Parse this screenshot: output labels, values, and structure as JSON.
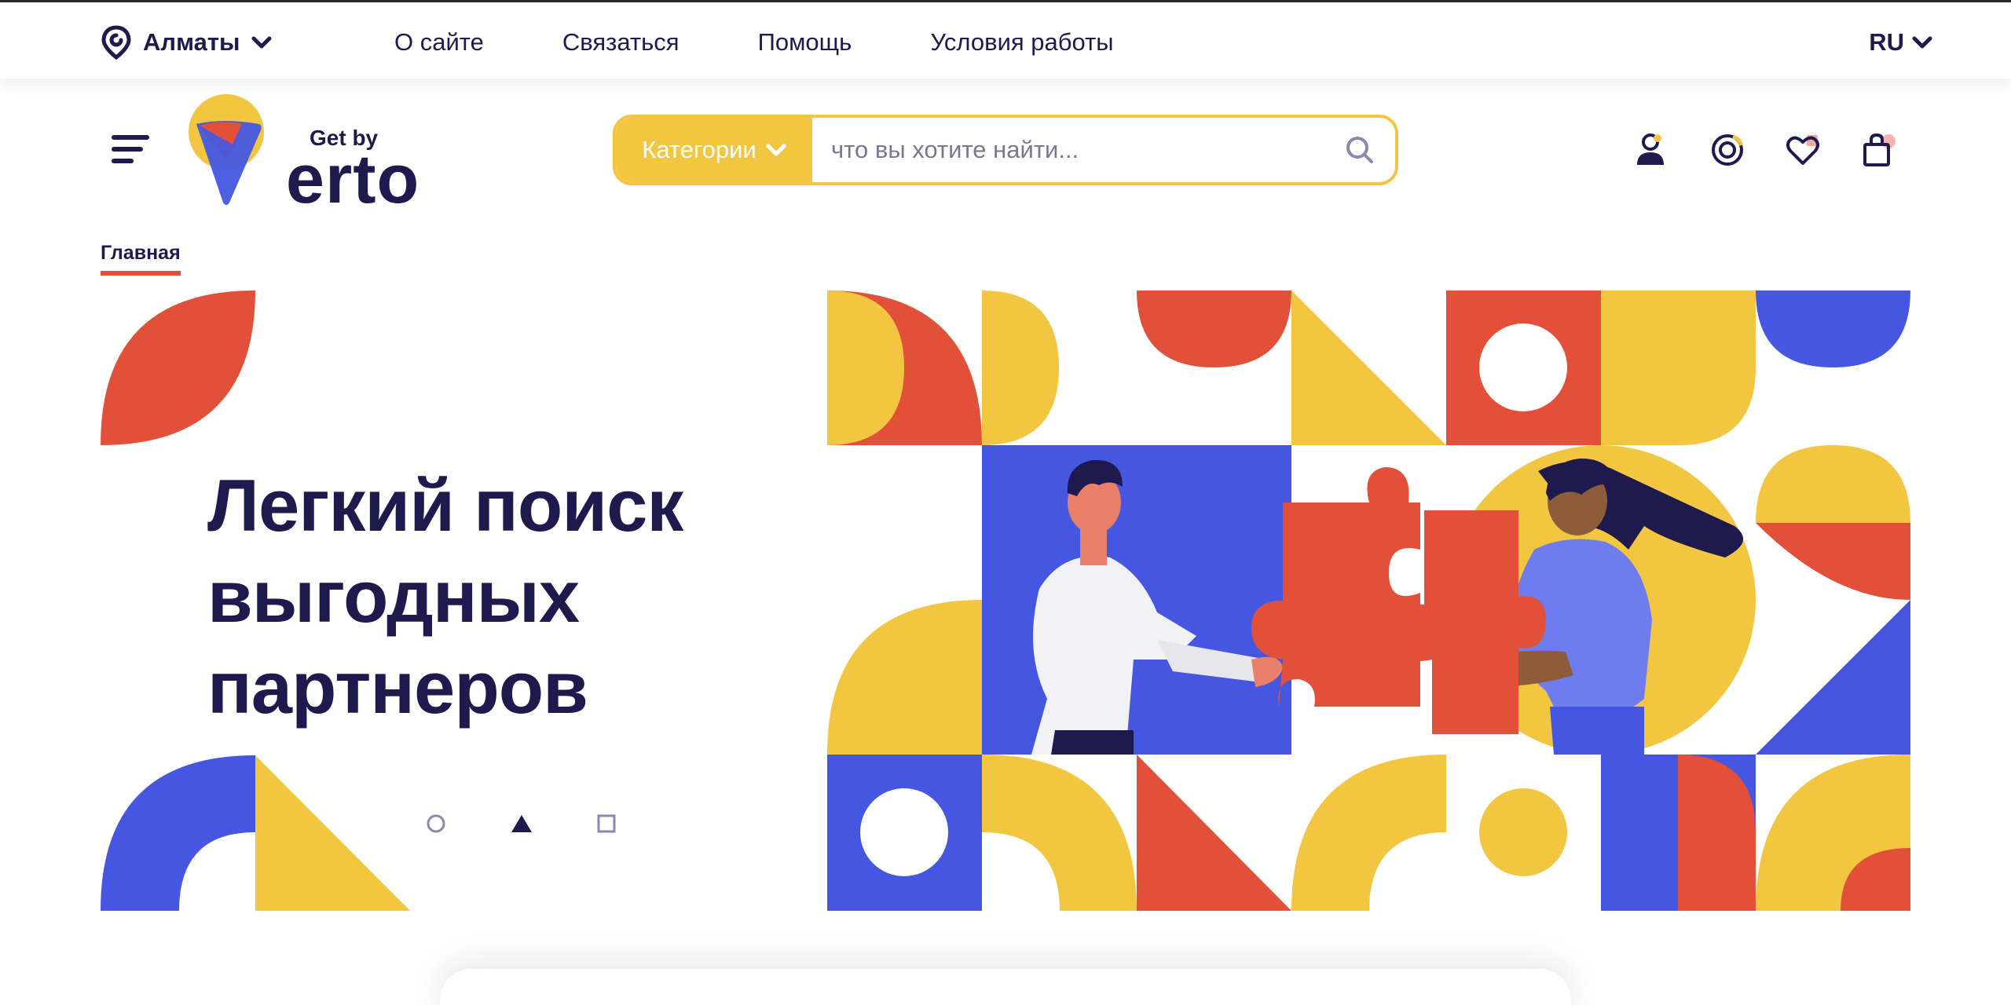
{
  "topbar": {
    "city": "Алматы",
    "nav": [
      "О сайте",
      "Связаться",
      "Помощь",
      "Условия работы"
    ],
    "lang": "RU"
  },
  "header": {
    "logo": {
      "top": "Get by",
      "bottom": "erto"
    },
    "categories_label": "Категории",
    "search_placeholder": "что вы хотите найти..."
  },
  "breadcrumb": {
    "current": "Главная"
  },
  "hero": {
    "title_lines": [
      "Легкий поиск",
      "выгодных",
      "партнеров"
    ]
  },
  "colors": {
    "navy": "#1e1a4d",
    "yellow": "#f3c642",
    "red": "#e3503a",
    "blue": "#4557e0",
    "white": "#ffffff"
  },
  "icons": [
    "location-pin-icon",
    "chevron-down-icon",
    "burger-menu-icon",
    "search-icon",
    "user-icon",
    "compare-icon",
    "heart-icon",
    "bag-icon"
  ]
}
